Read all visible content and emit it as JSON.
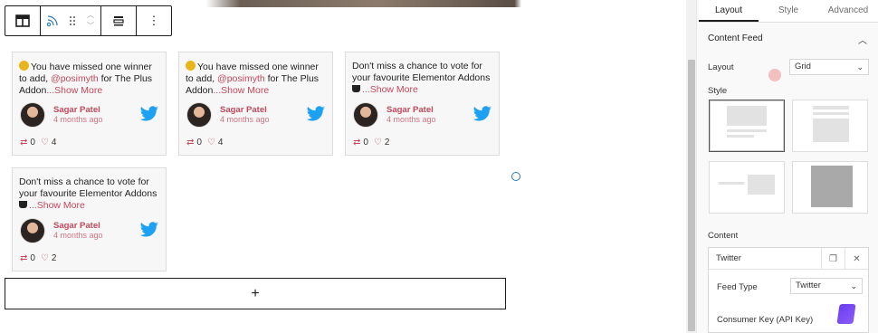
{
  "editor": {
    "toolbar": {
      "more_label": "⋮"
    },
    "feed": {
      "cards": [
        {
          "text_prefix": "You have missed one winner to add, ",
          "mention": "@posimyth",
          "text_suffix": " for The Plus Addon",
          "more": "...Show More",
          "emoji": "thinking-face",
          "author": "Sagar Patel",
          "time": "4 months ago",
          "retweets": "0",
          "likes": "4"
        },
        {
          "text_prefix": "You have missed one winner to add, ",
          "mention": "@posimyth",
          "text_suffix": " for The Plus Addon",
          "more": "...Show More",
          "emoji": "thinking-face",
          "author": "Sagar Patel",
          "time": "4 months ago",
          "retweets": "0",
          "likes": "4"
        },
        {
          "text_prefix": "Don't miss a chance to vote for your favourite Elementor Addons",
          "more": "...Show More",
          "emoji": "cup",
          "author": "Sagar Patel",
          "time": "4 months ago",
          "retweets": "0",
          "likes": "2"
        },
        {
          "text_prefix": "Don't miss a chance to vote for your favourite Elementor Addons",
          "more": "...Show More",
          "emoji": "cup",
          "author": "Sagar Patel",
          "time": "4 months ago",
          "retweets": "0",
          "likes": "2"
        }
      ]
    },
    "appender_label": "+"
  },
  "sidebar": {
    "tabs": [
      "Layout",
      "Style",
      "Advanced"
    ],
    "active_tab": "Layout",
    "section_title": "Content Feed",
    "layout_label": "Layout",
    "layout_value": "Grid",
    "style_label": "Style",
    "content_label": "Content",
    "twitter_panel": {
      "title": "Twitter",
      "feed_type_label": "Feed Type",
      "feed_type_value": "Twitter",
      "consumer_key_label": "Consumer Key (API Key)"
    }
  },
  "colors": {
    "accent": "#c2485b",
    "twitter": "#1da1f2",
    "spinner": "#2a7ab5"
  }
}
